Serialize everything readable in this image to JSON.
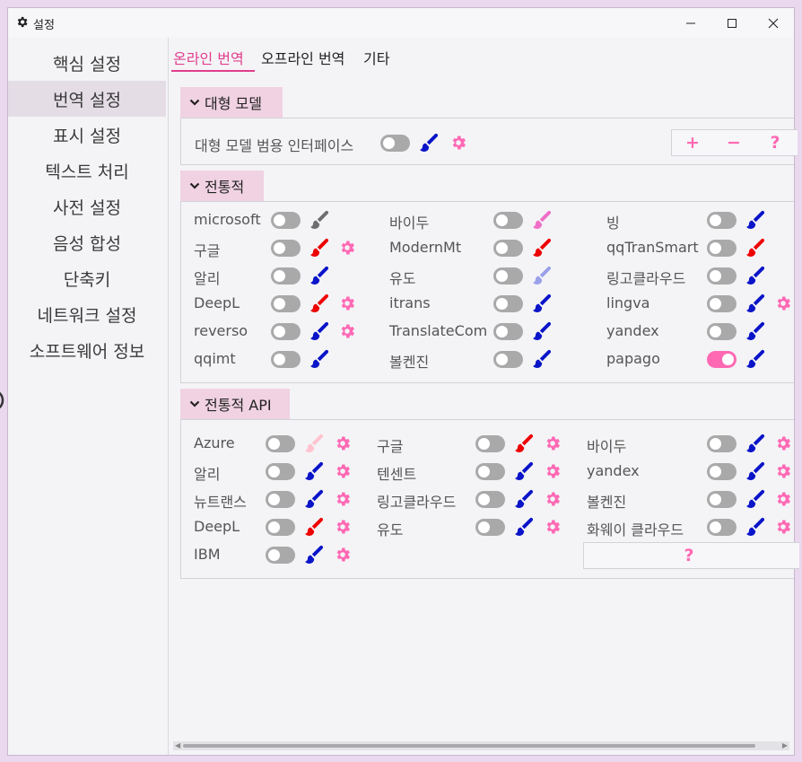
{
  "window": {
    "title": "설정"
  },
  "sidebar": {
    "items": [
      {
        "label": "핵심 설정"
      },
      {
        "label": "번역 설정"
      },
      {
        "label": "표시 설정"
      },
      {
        "label": "텍스트 처리"
      },
      {
        "label": "사전 설정"
      },
      {
        "label": "음성 합성"
      },
      {
        "label": "단축키"
      },
      {
        "label": "네트워크 설정"
      },
      {
        "label": "소프트웨어 정보"
      }
    ],
    "active_index": 1
  },
  "tabs": [
    {
      "label": "온라인 번역"
    },
    {
      "label": "오프라인 번역"
    },
    {
      "label": "기타"
    }
  ],
  "active_tab": 0,
  "colors": {
    "accent": "#ff69b4",
    "red": "#ee0000",
    "blue": "#0a14c8",
    "gray": "#6e6e6e",
    "pink": "#f070c8",
    "lavender": "#9aa0e8",
    "lightpink": "#ffc3cf"
  },
  "groups": {
    "llm": {
      "title": "대형 모델",
      "item": {
        "name": "대형 모델 범용 인터페이스",
        "on": false,
        "brush": "blue",
        "gear": true
      },
      "buttons": [
        "+",
        "−",
        "?"
      ]
    },
    "traditional": {
      "title": "전통적",
      "items": [
        {
          "name": "microsoft",
          "on": false,
          "brush": "gray",
          "gear": false
        },
        {
          "name": "바이두",
          "on": false,
          "brush": "pink",
          "gear": false
        },
        {
          "name": "빙",
          "on": false,
          "brush": "blue",
          "gear": false
        },
        {
          "name": "구글",
          "on": false,
          "brush": "red",
          "gear": true
        },
        {
          "name": "ModernMt",
          "on": false,
          "brush": "red",
          "gear": false
        },
        {
          "name": "qqTranSmart",
          "on": false,
          "brush": "red",
          "gear": false
        },
        {
          "name": "알리",
          "on": false,
          "brush": "blue",
          "gear": false
        },
        {
          "name": "유도",
          "on": false,
          "brush": "lavender",
          "gear": false
        },
        {
          "name": "링고클라우드",
          "on": false,
          "brush": "blue",
          "gear": false
        },
        {
          "name": "DeepL",
          "on": false,
          "brush": "red",
          "gear": true
        },
        {
          "name": "itrans",
          "on": false,
          "brush": "blue",
          "gear": false
        },
        {
          "name": "lingva",
          "on": false,
          "brush": "blue",
          "gear": true
        },
        {
          "name": "reverso",
          "on": false,
          "brush": "blue",
          "gear": true
        },
        {
          "name": "TranslateCom",
          "on": false,
          "brush": "blue",
          "gear": false
        },
        {
          "name": "yandex",
          "on": false,
          "brush": "blue",
          "gear": false
        },
        {
          "name": "qqimt",
          "on": false,
          "brush": "blue",
          "gear": false
        },
        {
          "name": "볼켄진",
          "on": false,
          "brush": "blue",
          "gear": false
        },
        {
          "name": "papago",
          "on": true,
          "brush": "blue",
          "gear": false
        }
      ]
    },
    "api": {
      "title": "전통적 API",
      "items": [
        {
          "name": "Azure",
          "on": false,
          "brush": "lightpink",
          "gear": true
        },
        {
          "name": "구글",
          "on": false,
          "brush": "red",
          "gear": true
        },
        {
          "name": "바이두",
          "on": false,
          "brush": "blue",
          "gear": true
        },
        {
          "name": "알리",
          "on": false,
          "brush": "blue",
          "gear": true
        },
        {
          "name": "텐센트",
          "on": false,
          "brush": "blue",
          "gear": true
        },
        {
          "name": "yandex",
          "on": false,
          "brush": "blue",
          "gear": true
        },
        {
          "name": "뉴트랜스",
          "on": false,
          "brush": "blue",
          "gear": true
        },
        {
          "name": "링고클라우드",
          "on": false,
          "brush": "blue",
          "gear": true
        },
        {
          "name": "볼켄진",
          "on": false,
          "brush": "blue",
          "gear": true
        },
        {
          "name": "DeepL",
          "on": false,
          "brush": "red",
          "gear": true
        },
        {
          "name": "유도",
          "on": false,
          "brush": "blue",
          "gear": true
        },
        {
          "name": "화웨이 클라우드",
          "on": false,
          "brush": "blue",
          "gear": true
        },
        {
          "name": "IBM",
          "on": false,
          "brush": "blue",
          "gear": true
        }
      ],
      "help_button": "?"
    }
  }
}
